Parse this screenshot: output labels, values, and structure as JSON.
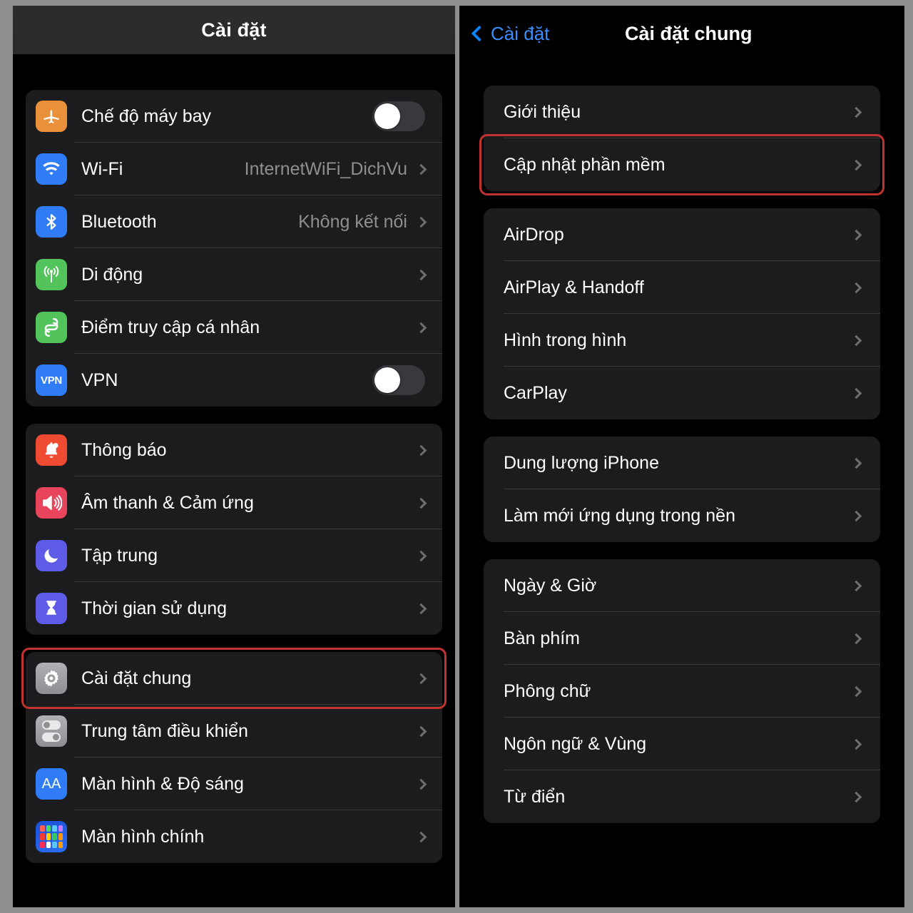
{
  "left_panel": {
    "header": {
      "title": "Cài đặt"
    },
    "groups": [
      {
        "id": "connectivity",
        "rows": [
          {
            "label": "Chế độ máy bay",
            "icon": "airplane-icon",
            "icon_color": "#e8913a",
            "control": "toggle",
            "toggle_on": false
          },
          {
            "label": "Wi-Fi",
            "icon": "wifi-icon",
            "icon_color": "#2f7cf6",
            "control": "chevron",
            "value": "InternetWiFi_DichVu"
          },
          {
            "label": "Bluetooth",
            "icon": "bluetooth-icon",
            "icon_color": "#2f7cf6",
            "control": "chevron",
            "value": "Không kết nối"
          },
          {
            "label": "Di động",
            "icon": "cellular-icon",
            "icon_color": "#53c45c",
            "control": "chevron",
            "value": ""
          },
          {
            "label": "Điểm truy cập cá nhân",
            "icon": "hotspot-icon",
            "icon_color": "#53c45c",
            "control": "chevron",
            "value": ""
          },
          {
            "label": "VPN",
            "icon": "vpn-icon",
            "icon_color": "#2f7cf6",
            "control": "toggle",
            "toggle_on": false
          }
        ]
      },
      {
        "id": "notifications",
        "rows": [
          {
            "label": "Thông báo",
            "icon": "bell-icon",
            "icon_color": "#ef4b33",
            "control": "chevron",
            "value": ""
          },
          {
            "label": "Âm thanh & Cảm ứng",
            "icon": "speaker-icon",
            "icon_color": "#e8445c",
            "control": "chevron",
            "value": ""
          },
          {
            "label": "Tập trung",
            "icon": "moon-icon",
            "icon_color": "#5e5ce6",
            "control": "chevron",
            "value": ""
          },
          {
            "label": "Thời gian sử dụng",
            "icon": "hourglass-icon",
            "icon_color": "#5e5ce6",
            "control": "chevron",
            "value": ""
          }
        ]
      },
      {
        "id": "system",
        "rows": [
          {
            "label": "Cài đặt chung",
            "icon": "gear-icon",
            "icon_color": "#8e8e93",
            "control": "chevron",
            "value": "",
            "highlighted": true
          },
          {
            "label": "Trung tâm điều khiển",
            "icon": "control-center-icon",
            "icon_color": "#8e8e93",
            "control": "chevron",
            "value": ""
          },
          {
            "label": "Màn hình & Độ sáng",
            "icon": "display-aa-icon",
            "icon_color": "#2f7cf6",
            "control": "chevron",
            "value": ""
          },
          {
            "label": "Màn hình chính",
            "icon": "home-screen-icon",
            "icon_color": "#1b4fd8",
            "control": "chevron",
            "value": ""
          }
        ]
      }
    ]
  },
  "right_panel": {
    "header": {
      "back_label": "Cài đặt",
      "title": "Cài đặt chung",
      "back_icon": "chevron-left-icon"
    },
    "groups": [
      {
        "id": "about",
        "rows": [
          {
            "label": "Giới thiệu",
            "control": "chevron"
          },
          {
            "label": "Cập nhật phần mềm",
            "control": "chevron",
            "highlighted": true
          }
        ]
      },
      {
        "id": "sharing",
        "rows": [
          {
            "label": "AirDrop",
            "control": "chevron"
          },
          {
            "label": "AirPlay & Handoff",
            "control": "chevron"
          },
          {
            "label": "Hình trong hình",
            "control": "chevron"
          },
          {
            "label": "CarPlay",
            "control": "chevron"
          }
        ]
      },
      {
        "id": "storage",
        "rows": [
          {
            "label": "Dung lượng iPhone",
            "control": "chevron"
          },
          {
            "label": "Làm mới ứng dụng trong nền",
            "control": "chevron"
          }
        ]
      },
      {
        "id": "locale",
        "rows": [
          {
            "label": "Ngày & Giờ",
            "control": "chevron"
          },
          {
            "label": "Bàn phím",
            "control": "chevron"
          },
          {
            "label": "Phông chữ",
            "control": "chevron"
          },
          {
            "label": "Ngôn ngữ & Vùng",
            "control": "chevron"
          },
          {
            "label": "Từ điển",
            "control": "chevron"
          }
        ]
      }
    ]
  },
  "colors": {
    "highlight": "#c0332f",
    "accent_blue": "#0a84ff",
    "card_bg": "#1c1c1e",
    "page_bg": "#000000",
    "separator": "#38383a",
    "secondary_text": "#8e8e93"
  }
}
